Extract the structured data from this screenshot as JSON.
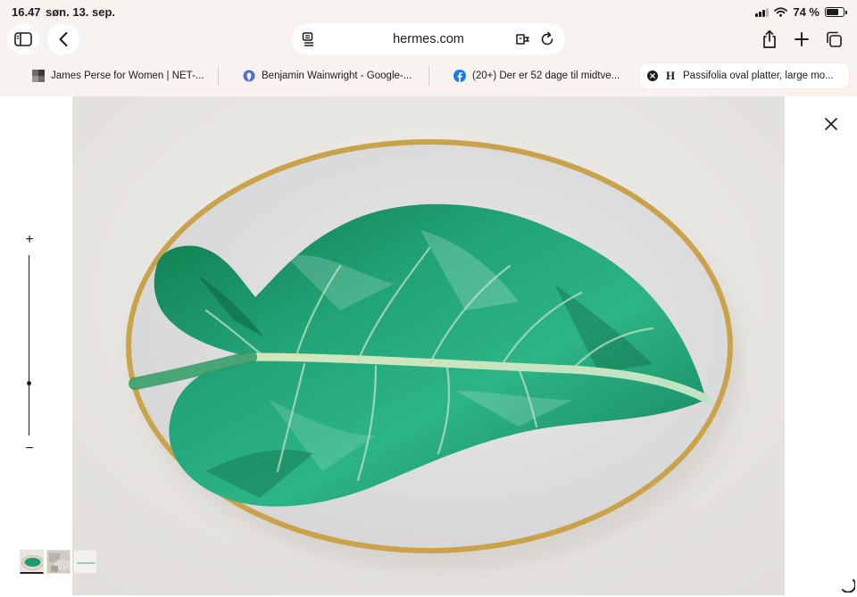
{
  "status_bar": {
    "time": "16.47",
    "date": "søn. 13. sep.",
    "battery": "74 %",
    "battery_level": 0.74
  },
  "address_bar": {
    "domain": "hermes.com"
  },
  "tabs": [
    {
      "title": "James Perse for Women | NET-...",
      "icon": "net-a-porter-favicon",
      "active": false
    },
    {
      "title": "Benjamin Wainwright - Google-...",
      "icon": "google-maps-favicon",
      "active": false
    },
    {
      "title": "(20+) Der er 52 dage til midtve...",
      "icon": "facebook-favicon",
      "active": false
    },
    {
      "title": "Passifolia oval platter, large mo...",
      "icon": "hermes-favicon",
      "active": true
    }
  ],
  "favicon_text": {
    "hermes": "H"
  },
  "viewer": {
    "product_image": "passifolia-oval-platter-green-leaf",
    "zoom_level": 0.29,
    "zoom_in": "+",
    "zoom_out": "−"
  },
  "thumbnails": [
    {
      "name": "thumbnail-leaf-platter",
      "selected": true
    },
    {
      "name": "thumbnail-lifestyle",
      "selected": false
    },
    {
      "name": "thumbnail-side-view",
      "selected": false
    }
  ],
  "colors": {
    "chrome_bg": "#f8f3ee",
    "leaf": "#1f9a6e",
    "gold_rim": "#c9a24a",
    "photo_bg": "#ebe9e5"
  }
}
